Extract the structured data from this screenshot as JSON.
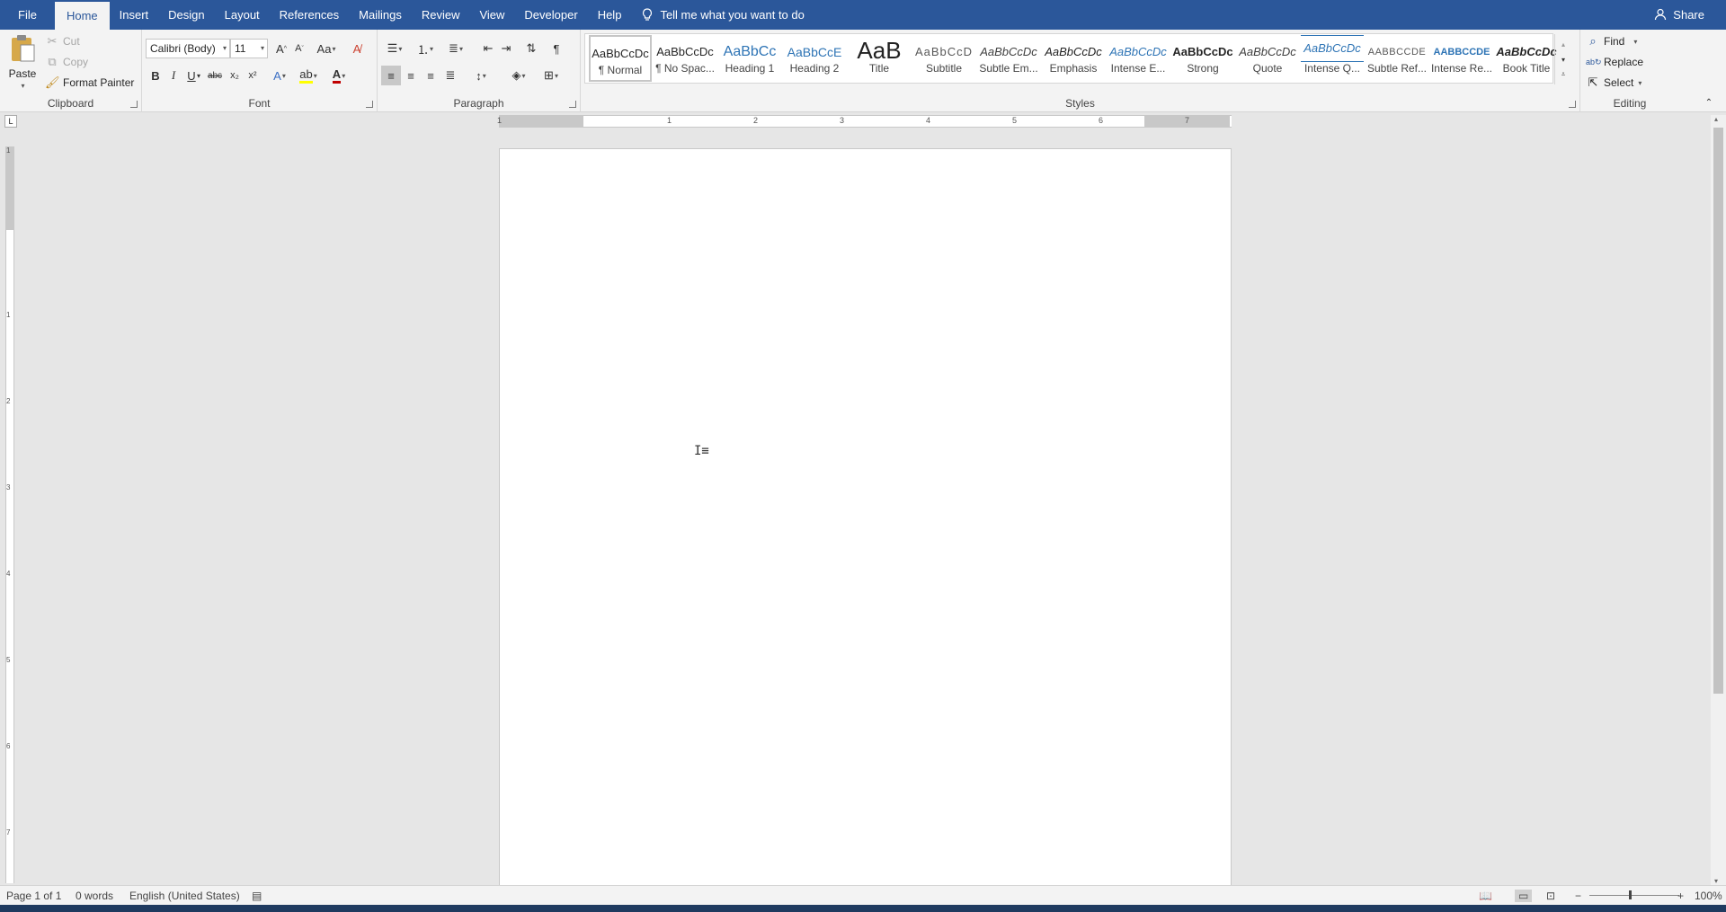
{
  "tabs": [
    "File",
    "Home",
    "Insert",
    "Design",
    "Layout",
    "References",
    "Mailings",
    "Review",
    "View",
    "Developer",
    "Help"
  ],
  "active_tab": "Home",
  "tell_me": "Tell me what you want to do",
  "share": "Share",
  "clipboard": {
    "paste": "Paste",
    "cut": "Cut",
    "copy": "Copy",
    "format_painter": "Format Painter",
    "label": "Clipboard"
  },
  "font": {
    "name": "Calibri (Body)",
    "size": "11",
    "label": "Font",
    "bold": "B",
    "italic": "I",
    "underline": "U",
    "strike": "abc",
    "subscript": "x₂",
    "superscript": "x²"
  },
  "paragraph": {
    "label": "Paragraph"
  },
  "styles": {
    "label": "Styles",
    "items": [
      {
        "sample": "AaBbCcDc",
        "name": "¶ Normal"
      },
      {
        "sample": "AaBbCcDc",
        "name": "¶ No Spac..."
      },
      {
        "sample": "AaBbCc",
        "name": "Heading 1"
      },
      {
        "sample": "AaBbCcE",
        "name": "Heading 2"
      },
      {
        "sample": "AaB",
        "name": "Title"
      },
      {
        "sample": "AaBbCcD",
        "name": "Subtitle"
      },
      {
        "sample": "AaBbCcDc",
        "name": "Subtle Em..."
      },
      {
        "sample": "AaBbCcDc",
        "name": "Emphasis"
      },
      {
        "sample": "AaBbCcDc",
        "name": "Intense E..."
      },
      {
        "sample": "AaBbCcDc",
        "name": "Strong"
      },
      {
        "sample": "AaBbCcDc",
        "name": "Quote"
      },
      {
        "sample": "AaBbCcDc",
        "name": "Intense Q..."
      },
      {
        "sample": "AABBCCDE",
        "name": "Subtle Ref..."
      },
      {
        "sample": "AABBCCDE",
        "name": "Intense Re..."
      },
      {
        "sample": "AaBbCcDc",
        "name": "Book Title"
      }
    ]
  },
  "editing": {
    "find": "Find",
    "replace": "Replace",
    "select": "Select",
    "label": "Editing"
  },
  "ruler_numbers": [
    "1",
    "1",
    "2",
    "3",
    "4",
    "5",
    "6",
    "7"
  ],
  "vruler_numbers": [
    "1",
    "1",
    "2",
    "3",
    "4",
    "5",
    "6",
    "7"
  ],
  "status": {
    "page": "Page 1 of 1",
    "words": "0 words",
    "language": "English (United States)",
    "zoom": "100%"
  },
  "colors": {
    "brand": "#2b579a",
    "ribbon": "#f3f3f3",
    "canvas": "#e6e6e6"
  }
}
